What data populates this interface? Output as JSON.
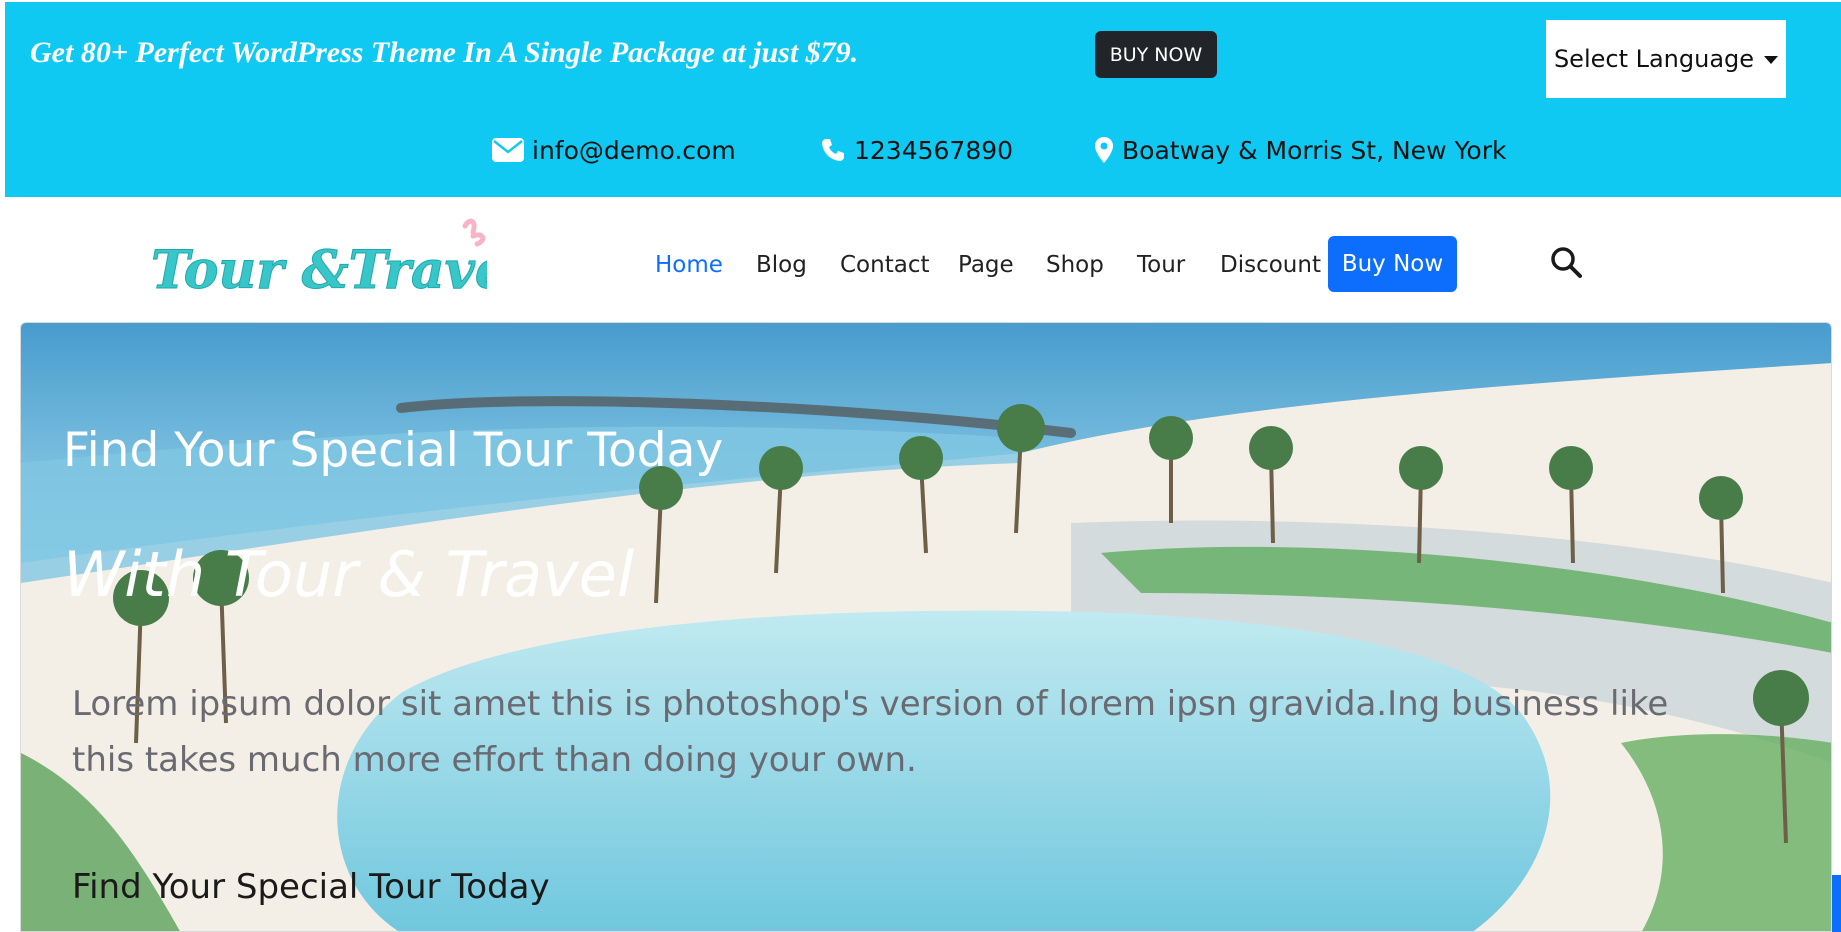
{
  "topbar": {
    "promo_text": "Get 80+ Perfect WordPress Theme In A Single Package at just $79.",
    "buy_now_label": "BUY NOW",
    "language_label": "Select Language",
    "background_color": "#0fc9f2"
  },
  "contacts": {
    "email": {
      "icon": "envelope-icon",
      "text": "info@demo.com"
    },
    "phone": {
      "icon": "phone-icon",
      "text": "1234567890"
    },
    "address": {
      "icon": "map-pin-icon",
      "text": "Boatway & Morris St, New York"
    }
  },
  "header": {
    "logo_text": "Tour &Travel",
    "nav_items": [
      "Home",
      "Blog",
      "Contact",
      "Page",
      "Shop",
      "Tour",
      "Discount"
    ],
    "active_item": "Home",
    "cta_label": "Buy Now",
    "accent_color": "#0d6efd",
    "search_icon": "search-icon"
  },
  "hero": {
    "title": "Find Your Special Tour Today",
    "subtitle": "With Tour & Travel",
    "description": "Lorem ipsum dolor sit amet this is photoshop's version of lorem ipsn gravida.Ing business like this takes much more effort than doing your own.",
    "secondary_title": "Find Your Special Tour Today",
    "background_image": "tropical beach lagoon with palm trees"
  }
}
